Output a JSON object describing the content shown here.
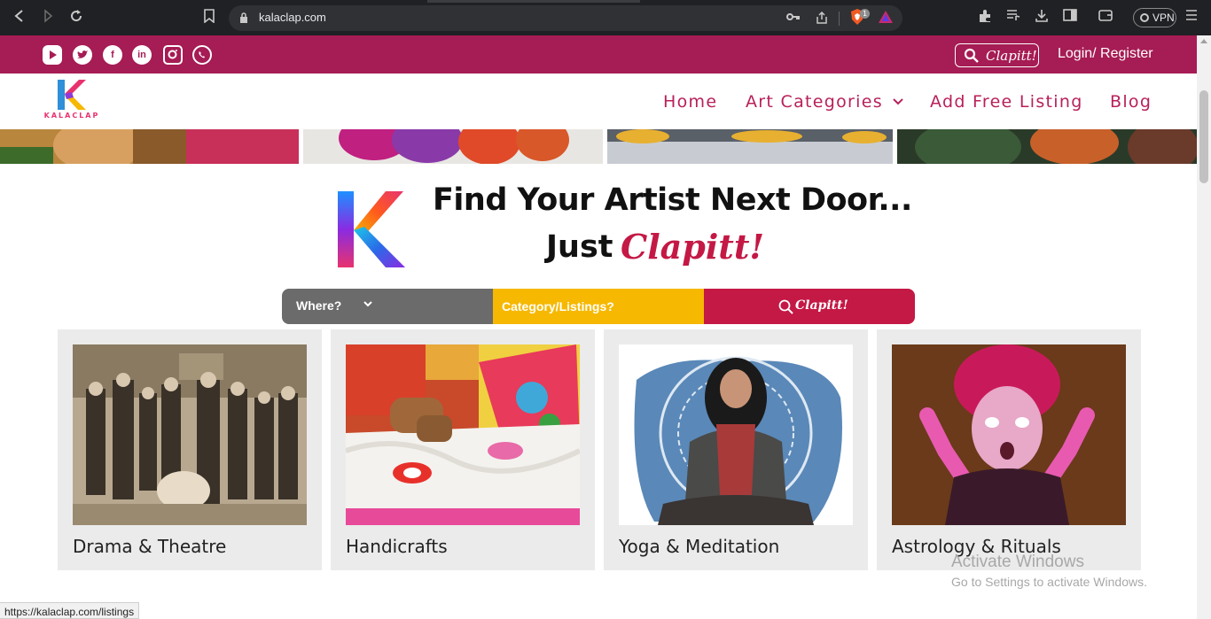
{
  "browser": {
    "url": "kalaclap.com",
    "vpn_label": "VPN",
    "brave_badge": "1",
    "icons": [
      "back-icon",
      "forward-icon",
      "reload-icon",
      "bookmark-icon",
      "lock-icon",
      "key-icon",
      "share-icon",
      "brave-shield-icon",
      "brave-rewards-icon",
      "extensions-icon",
      "playlist-icon",
      "download-icon",
      "sidebar-icon",
      "wallet-icon",
      "vpn-icon",
      "menu-icon"
    ]
  },
  "topbar": {
    "social_icons": [
      "youtube-icon",
      "twitter-icon",
      "facebook-icon",
      "linkedin-icon",
      "instagram-icon",
      "whatsapp-icon"
    ],
    "search_label": "Clapitt!",
    "login_label": "Login/ Register"
  },
  "header": {
    "logo_letter": "K",
    "logo_text": "KALACLAP",
    "nav": {
      "home": "Home",
      "art_categories": "Art Categories",
      "add_listing": "Add Free Listing",
      "blog": "Blog"
    }
  },
  "hero": {
    "line1": "Find Your Artist Next Door...",
    "line2_prefix": "Just",
    "line2_brand": "Clapitt!"
  },
  "search": {
    "where_label": "Where?",
    "category_placeholder": "Category/Listings?",
    "submit_label": "Clapitt!"
  },
  "categories": [
    {
      "title": "Drama & Theatre"
    },
    {
      "title": "Handicrafts"
    },
    {
      "title": "Yoga & Meditation"
    },
    {
      "title": "Astrology & Rituals"
    }
  ],
  "watermark": {
    "line1": "Activate Windows",
    "line2": "Go to Settings to activate Windows."
  },
  "status_bar": {
    "link": "https://kalaclap.com/listings"
  },
  "colors": {
    "brand": "#a61c54",
    "accent_red": "#c41845",
    "accent_yellow": "#f6b800",
    "search_grey": "#6b6b6b",
    "card_bg": "#ebebeb"
  }
}
